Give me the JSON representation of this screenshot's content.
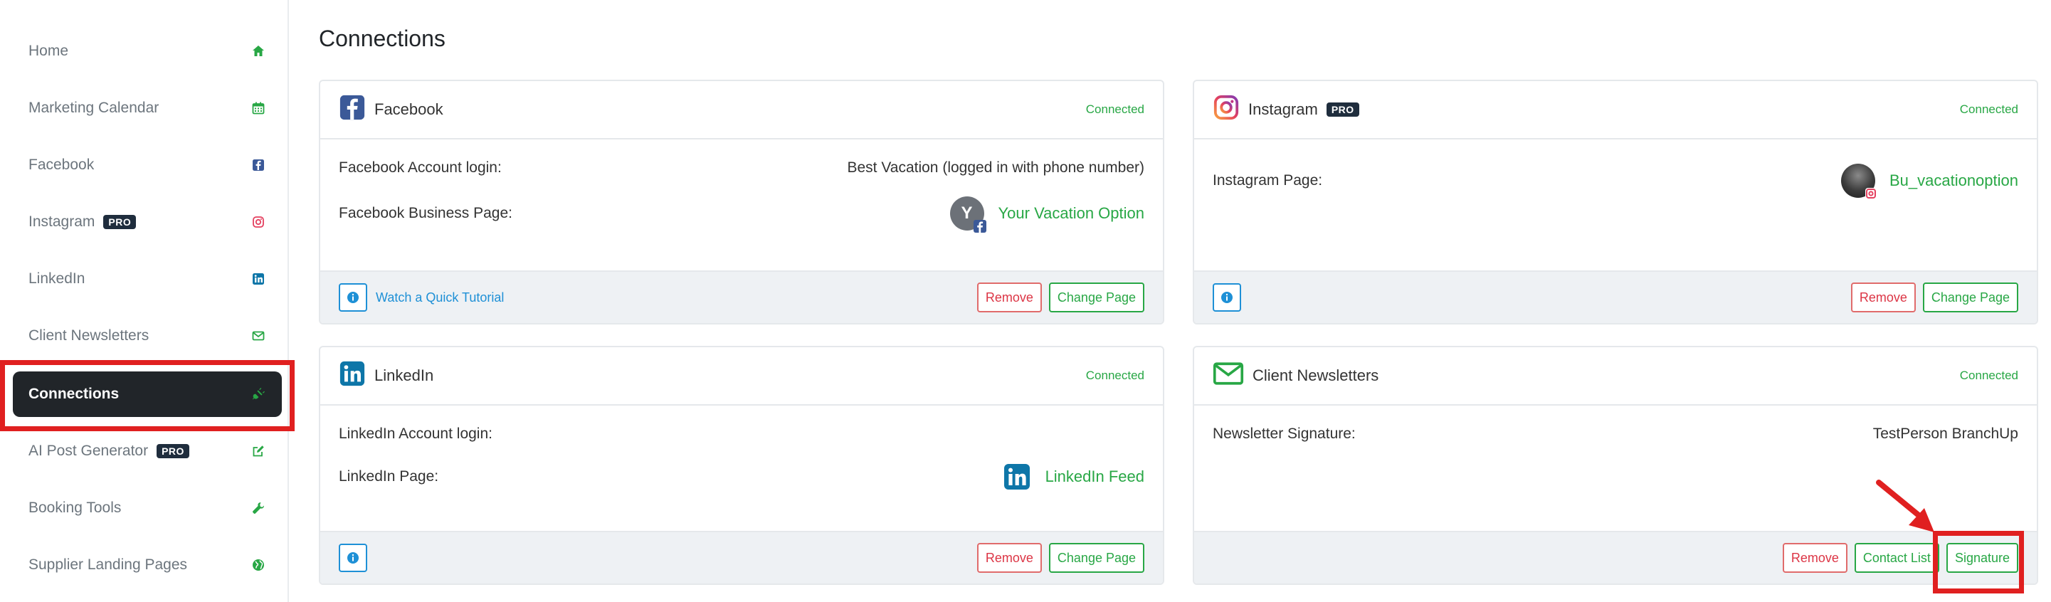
{
  "sidebar": {
    "items": [
      {
        "label": "Home",
        "icon": "home-icon"
      },
      {
        "label": "Marketing Calendar",
        "icon": "calendar-icon"
      },
      {
        "label": "Facebook",
        "icon": "facebook-icon"
      },
      {
        "label": "Instagram",
        "badge": "PRO",
        "icon": "instagram-icon"
      },
      {
        "label": "LinkedIn",
        "icon": "linkedin-icon"
      },
      {
        "label": "Client Newsletters",
        "icon": "envelope-icon"
      },
      {
        "label": "Connections",
        "icon": "plug-icon",
        "active": true
      },
      {
        "label": "AI Post Generator",
        "badge": "PRO",
        "icon": "edit-icon"
      },
      {
        "label": "Booking Tools",
        "icon": "wrench-icon"
      },
      {
        "label": "Supplier Landing Pages",
        "icon": "globe-icon"
      }
    ]
  },
  "main": {
    "title": "Connections",
    "cards": {
      "facebook": {
        "title": "Facebook",
        "status": "Connected",
        "rows": [
          {
            "label": "Facebook Account login:",
            "value": "Best Vacation (logged in with phone number)"
          },
          {
            "label": "Facebook Business Page:",
            "value": "Your Vacation Option",
            "avatar_letter": "Y"
          }
        ],
        "tutorial": "Watch a Quick Tutorial",
        "remove": "Remove",
        "change": "Change Page"
      },
      "instagram": {
        "title": "Instagram",
        "badge": "PRO",
        "status": "Connected",
        "rows": [
          {
            "label": "Instagram Page:",
            "value": "Bu_vacationoption"
          }
        ],
        "remove": "Remove",
        "change": "Change Page"
      },
      "linkedin": {
        "title": "LinkedIn",
        "status": "Connected",
        "rows": [
          {
            "label": "LinkedIn Account login:",
            "value": ""
          },
          {
            "label": "LinkedIn Page:",
            "value": "LinkedIn Feed"
          }
        ],
        "remove": "Remove",
        "change": "Change Page"
      },
      "newsletters": {
        "title": "Client Newsletters",
        "status": "Connected",
        "rows": [
          {
            "label": "Newsletter Signature:",
            "value": "TestPerson BranchUp"
          }
        ],
        "remove": "Remove",
        "contact": "Contact List",
        "signature": "Signature"
      }
    }
  },
  "colors": {
    "accent_green": "#28a745",
    "info_blue": "#1e90d6",
    "danger_red": "#dc3545",
    "highlight_red": "#e02020",
    "active_nav_bg": "#212529",
    "facebook_blue": "#3b5998",
    "linkedin_blue": "#0e76a8"
  }
}
